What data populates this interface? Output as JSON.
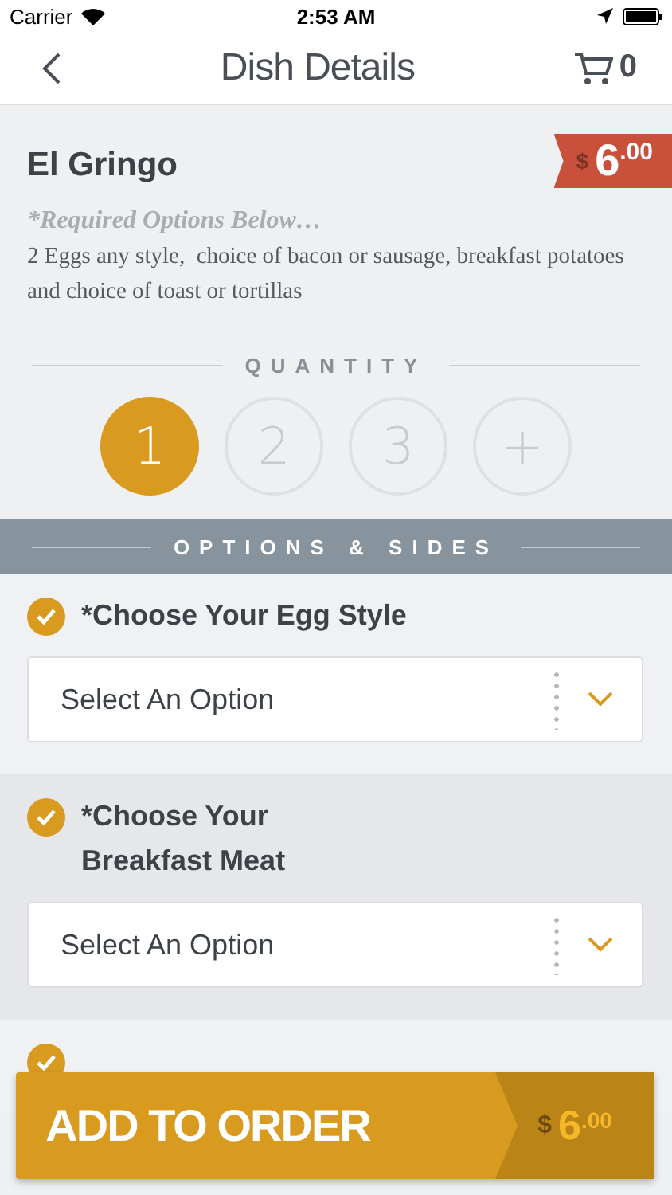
{
  "status_bar": {
    "carrier": "Carrier",
    "time": "2:53 AM"
  },
  "nav": {
    "title": "Dish Details",
    "cart_count": "0"
  },
  "dish": {
    "name": "El Gringo",
    "price": {
      "currency": "$",
      "whole": "6",
      "cents": ".00"
    },
    "note": "*Required Options Below…",
    "description": "2 Eggs any style,  choice of bacon or sausage, breakfast potatoes and choice of toast or tortillas"
  },
  "quantity": {
    "label": "QUANTITY",
    "options": [
      {
        "label": "1",
        "selected": true
      },
      {
        "label": "2",
        "selected": false
      },
      {
        "label": "3",
        "selected": false
      },
      {
        "label": "+",
        "selected": false
      }
    ]
  },
  "options_header": "OPTIONS & SIDES",
  "options": [
    {
      "title": "*Choose Your Egg Style",
      "checked": true,
      "placeholder": "Select An Option"
    },
    {
      "title": "*Choose Your\nBreakfast Meat",
      "checked": true,
      "placeholder": "Select An Option"
    },
    {
      "checked": true
    }
  ],
  "add_button": {
    "label": "ADD TO ORDER",
    "price": {
      "currency": "$",
      "whole": "6",
      "cents": ".00"
    }
  }
}
